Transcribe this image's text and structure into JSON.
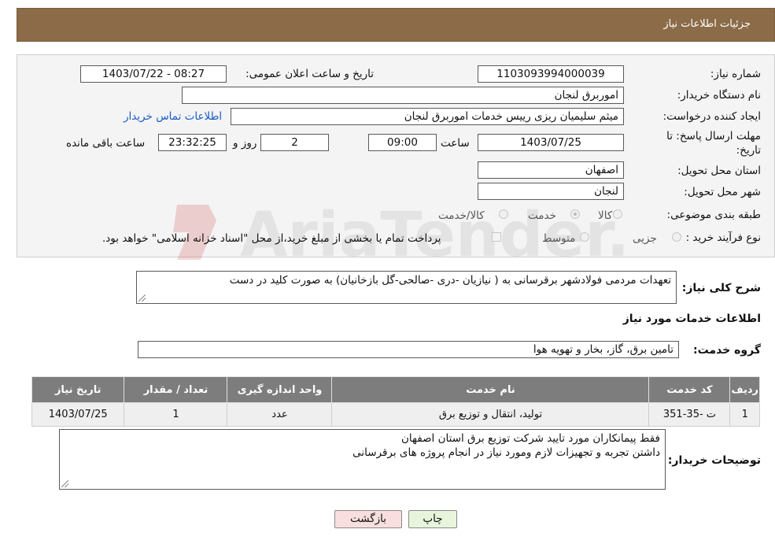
{
  "header": {
    "title": "جزئیات اطلاعات نیاز"
  },
  "form": {
    "need_number": {
      "label": "شماره نیاز:",
      "value": "1103093994000039"
    },
    "announce_datetime": {
      "label": "تاریخ و ساعت اعلان عمومی:",
      "value": "1403/07/22 - 08:27"
    },
    "buyer_org": {
      "label": "نام دستگاه خریدار:",
      "value": "اموربرق لنجان"
    },
    "requester": {
      "label": "ایجاد کننده درخواست:",
      "value": "میثم سلیمیان ریزی رییس خدمات  اموربرق لنجان"
    },
    "contact_link": "اطلاعات تماس خریدار",
    "deadline": {
      "label_line1": "مهلت ارسال پاسخ: تا",
      "label_line2": "تاریخ:",
      "date": "1403/07/25",
      "time_label": "ساعت",
      "time": "09:00",
      "days": "2",
      "days_label": "روز و",
      "remaining": "23:32:25",
      "remaining_label": "ساعت باقی مانده"
    },
    "province": {
      "label": "استان محل تحویل:",
      "value": "اصفهان"
    },
    "city": {
      "label": "شهر محل تحویل:",
      "value": "لنجان"
    },
    "category": {
      "label": "طبقه بندی موضوعی:",
      "options": [
        "کالا",
        "خدمت",
        "کالا/خدمت"
      ],
      "selected": "خدمت"
    },
    "purchase_type": {
      "label": "نوع فرآیند خرید :",
      "options": [
        "جزیی",
        "متوسط"
      ],
      "payment_note": "پرداخت تمام یا بخشی از مبلغ خرید،از محل \"اسناد خزانه اسلامی\" خواهد بود."
    }
  },
  "summary": {
    "label": "شرح کلی نیاز:",
    "value": "تعهدات مردمی فولادشهر برقرسانی به ( نیازیان -دری -صالحی-گل بازخانیان) به صورت کلید در دست"
  },
  "services_section": {
    "title": "اطلاعات خدمات مورد نیاز",
    "group_label": "گروه خدمت:",
    "group_value": "تامین برق، گاز، بخار و تهویه هوا"
  },
  "table": {
    "headers": [
      "ردیف",
      "کد خدمت",
      "نام خدمت",
      "واحد اندازه گیری",
      "تعداد / مقدار",
      "تاریخ نیاز"
    ],
    "rows": [
      [
        "1",
        "ت -35-351",
        "تولید، انتقال و توزیع برق",
        "عدد",
        "1",
        "1403/07/25"
      ]
    ]
  },
  "buyer_notes": {
    "label": "توضیحات خریدار:",
    "lines": [
      "فقط پیمانکاران مورد تایید شرکت توزیع برق استان اصفهان",
      "داشتن تجربه و تجهیزات لازم ومورد نیاز در انجام پروژه های برقرسانی"
    ]
  },
  "buttons": {
    "print": "چاپ",
    "back": "بازگشت"
  },
  "watermark": {
    "text": "AriaTender.neT"
  },
  "colors": {
    "header_bg": "#8b6b48",
    "table_header_bg": "#7d7d7d",
    "link": "#1a5bc9",
    "print_btn": "#e8f5dc",
    "back_btn": "#f8dede"
  }
}
